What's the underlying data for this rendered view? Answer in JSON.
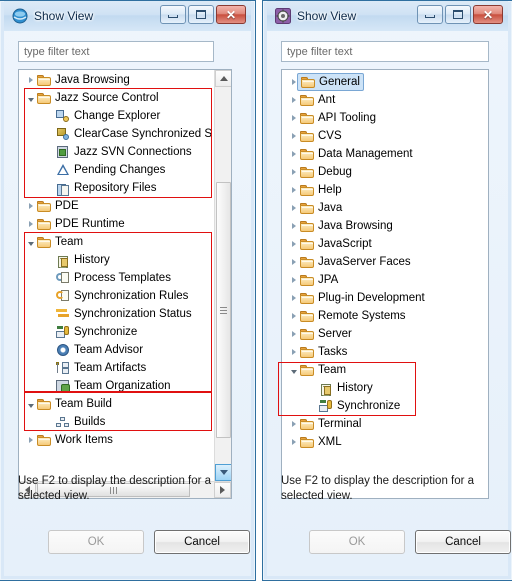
{
  "left_window": {
    "title": "Show View",
    "icon": "eclipse-view-icon",
    "buttons": {
      "minimize": "–",
      "maximize": "□",
      "close": "✕"
    },
    "filter": {
      "value": "",
      "placeholder": "type filter text"
    },
    "hint": "Use F2 to display the description for a selected view.",
    "ok_label": "OK",
    "ok_enabled": false,
    "cancel_label": "Cancel",
    "tree": [
      {
        "label": "Java Browsing",
        "level": 0,
        "icon": "folder-icon",
        "twisty": "closed",
        "highlight": false
      },
      {
        "label": "Jazz Source Control",
        "level": 0,
        "icon": "folder-icon",
        "twisty": "open",
        "highlight": true
      },
      {
        "label": "Change Explorer",
        "level": 1,
        "icon": "change-explorer-icon",
        "twisty": "none",
        "highlight": true
      },
      {
        "label": "ClearCase Synchronized S",
        "level": 1,
        "icon": "clearcase-sync-icon",
        "twisty": "none",
        "highlight": true
      },
      {
        "label": "Jazz SVN Connections",
        "level": 1,
        "icon": "svn-connection-icon",
        "twisty": "none",
        "highlight": true
      },
      {
        "label": "Pending Changes",
        "level": 1,
        "icon": "pending-changes-icon",
        "twisty": "none",
        "highlight": true
      },
      {
        "label": "Repository Files",
        "level": 1,
        "icon": "repository-files-icon",
        "twisty": "none",
        "highlight": true
      },
      {
        "label": "PDE",
        "level": 0,
        "icon": "folder-icon",
        "twisty": "closed",
        "highlight": false
      },
      {
        "label": "PDE Runtime",
        "level": 0,
        "icon": "folder-icon",
        "twisty": "closed",
        "highlight": false
      },
      {
        "label": "Team",
        "level": 0,
        "icon": "folder-icon",
        "twisty": "open",
        "highlight": true
      },
      {
        "label": "History",
        "level": 1,
        "icon": "history-icon",
        "twisty": "none",
        "highlight": true
      },
      {
        "label": "Process Templates",
        "level": 1,
        "icon": "process-templates-icon",
        "twisty": "none",
        "highlight": true
      },
      {
        "label": "Synchronization Rules",
        "level": 1,
        "icon": "sync-rules-icon",
        "twisty": "none",
        "highlight": true
      },
      {
        "label": "Synchronization Status",
        "level": 1,
        "icon": "sync-status-icon",
        "twisty": "none",
        "highlight": true
      },
      {
        "label": "Synchronize",
        "level": 1,
        "icon": "synchronize-icon",
        "twisty": "none",
        "highlight": true
      },
      {
        "label": "Team Advisor",
        "level": 1,
        "icon": "team-advisor-icon",
        "twisty": "none",
        "highlight": true
      },
      {
        "label": "Team Artifacts",
        "level": 1,
        "icon": "team-artifacts-icon",
        "twisty": "none",
        "highlight": true
      },
      {
        "label": "Team Organization",
        "level": 1,
        "icon": "team-organization-icon",
        "twisty": "none",
        "highlight": true
      },
      {
        "label": "Team Build",
        "level": 0,
        "icon": "folder-icon",
        "twisty": "open",
        "highlight": true
      },
      {
        "label": "Builds",
        "level": 1,
        "icon": "builds-icon",
        "twisty": "none",
        "highlight": true
      },
      {
        "label": "Work Items",
        "level": 0,
        "icon": "folder-icon",
        "twisty": "closed",
        "highlight": false
      }
    ]
  },
  "right_window": {
    "title": "Show View",
    "icon": "eclipse-preferences-icon",
    "buttons": {
      "minimize": "–",
      "maximize": "□",
      "close": "✕"
    },
    "filter": {
      "value": "",
      "placeholder": "type filter text"
    },
    "hint": "Use F2 to display the description for a selected view.",
    "ok_label": "OK",
    "ok_enabled": false,
    "cancel_label": "Cancel",
    "tree": [
      {
        "label": "General",
        "level": 0,
        "icon": "folder-icon",
        "twisty": "closed",
        "selected": true,
        "highlight": false
      },
      {
        "label": "Ant",
        "level": 0,
        "icon": "folder-icon",
        "twisty": "closed",
        "selected": false,
        "highlight": false
      },
      {
        "label": "API Tooling",
        "level": 0,
        "icon": "folder-icon",
        "twisty": "closed",
        "selected": false,
        "highlight": false
      },
      {
        "label": "CVS",
        "level": 0,
        "icon": "folder-icon",
        "twisty": "closed",
        "selected": false,
        "highlight": false
      },
      {
        "label": "Data Management",
        "level": 0,
        "icon": "folder-icon",
        "twisty": "closed",
        "selected": false,
        "highlight": false
      },
      {
        "label": "Debug",
        "level": 0,
        "icon": "folder-icon",
        "twisty": "closed",
        "selected": false,
        "highlight": false
      },
      {
        "label": "Help",
        "level": 0,
        "icon": "folder-icon",
        "twisty": "closed",
        "selected": false,
        "highlight": false
      },
      {
        "label": "Java",
        "level": 0,
        "icon": "folder-icon",
        "twisty": "closed",
        "selected": false,
        "highlight": false
      },
      {
        "label": "Java Browsing",
        "level": 0,
        "icon": "folder-icon",
        "twisty": "closed",
        "selected": false,
        "highlight": false
      },
      {
        "label": "JavaScript",
        "level": 0,
        "icon": "folder-icon",
        "twisty": "closed",
        "selected": false,
        "highlight": false
      },
      {
        "label": "JavaServer Faces",
        "level": 0,
        "icon": "folder-icon",
        "twisty": "closed",
        "selected": false,
        "highlight": false
      },
      {
        "label": "JPA",
        "level": 0,
        "icon": "folder-icon",
        "twisty": "closed",
        "selected": false,
        "highlight": false
      },
      {
        "label": "Plug-in Development",
        "level": 0,
        "icon": "folder-icon",
        "twisty": "closed",
        "selected": false,
        "highlight": false
      },
      {
        "label": "Remote Systems",
        "level": 0,
        "icon": "folder-icon",
        "twisty": "closed",
        "selected": false,
        "highlight": false
      },
      {
        "label": "Server",
        "level": 0,
        "icon": "folder-icon",
        "twisty": "closed",
        "selected": false,
        "highlight": false
      },
      {
        "label": "Tasks",
        "level": 0,
        "icon": "folder-icon",
        "twisty": "closed",
        "selected": false,
        "highlight": false
      },
      {
        "label": "Team",
        "level": 0,
        "icon": "folder-icon",
        "twisty": "open",
        "selected": false,
        "highlight": true
      },
      {
        "label": "History",
        "level": 1,
        "icon": "history-icon",
        "twisty": "none",
        "selected": false,
        "highlight": true
      },
      {
        "label": "Synchronize",
        "level": 1,
        "icon": "synchronize-icon",
        "twisty": "none",
        "selected": false,
        "highlight": true
      },
      {
        "label": "Terminal",
        "level": 0,
        "icon": "folder-icon",
        "twisty": "closed",
        "selected": false,
        "highlight": false
      },
      {
        "label": "XML",
        "level": 0,
        "icon": "folder-icon",
        "twisty": "closed",
        "selected": false,
        "highlight": false
      }
    ]
  },
  "colors": {
    "highlight_red": "#e01010",
    "aero_frame": "#d9e8f7",
    "frame_border": "#2f6f9f",
    "selection_blue": "#cde3f7",
    "folder_orange": "#f6c978"
  }
}
